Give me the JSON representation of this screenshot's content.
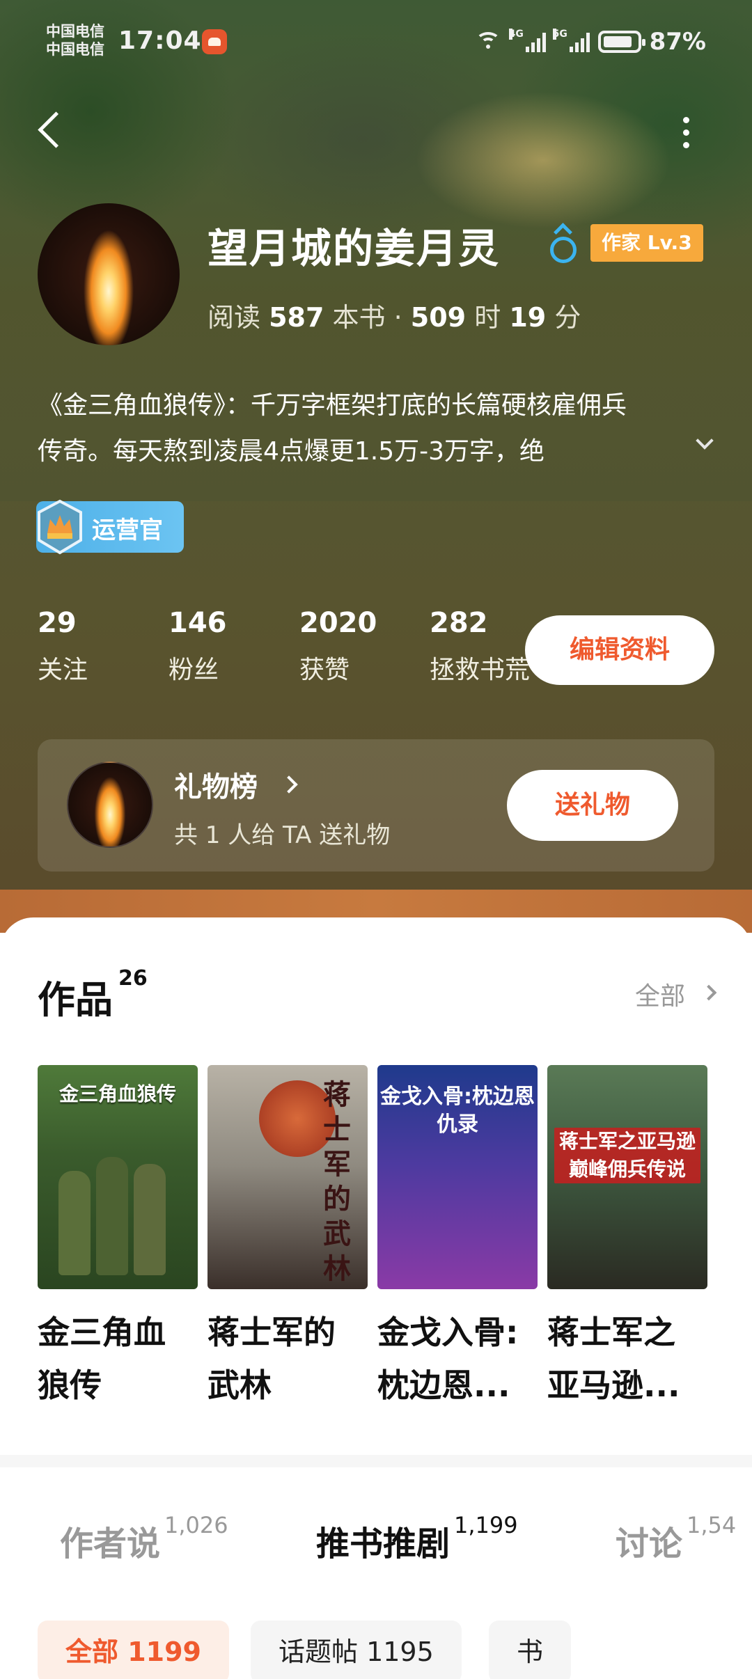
{
  "status_bar": {
    "carrier_1": "中国电信",
    "carrier_2": "中国电信",
    "time": "17:04",
    "net_1": "4G",
    "net_2": "5G",
    "battery": "87%"
  },
  "profile": {
    "username": "望月城的姜月灵",
    "level": "作家 Lv.3",
    "read_label": "阅读",
    "read_books": "587",
    "read_books_unit": "本书 ·",
    "read_hours": "509",
    "read_hours_unit": "时",
    "read_minutes": "19",
    "read_minutes_unit": "分",
    "bio_line1": "《金三角血狼传》：千万字框架打底的长篇硬核雇佣兵",
    "bio_line2": "传奇。每天熬到凌晨4点爆更1.5万-3万字，绝",
    "ops_badge": "运营官"
  },
  "stats": [
    {
      "num": "29",
      "label": "关注"
    },
    {
      "num": "146",
      "label": "粉丝"
    },
    {
      "num": "2020",
      "label": "获赞"
    },
    {
      "num": "282",
      "label": "拯救书荒"
    }
  ],
  "edit_button": "编辑资料",
  "gift": {
    "title": "礼物榜",
    "subtitle": "共 1 人给 TA 送礼物",
    "button": "送礼物"
  },
  "works": {
    "title": "作品",
    "count": "26",
    "all": "全部",
    "books": [
      {
        "title": "金三角血狼传",
        "title_lines": [
          "金三角血",
          "狼传"
        ],
        "cover_text": "金三角血狼传"
      },
      {
        "title": "蒋士军的武林",
        "title_lines": [
          "蒋士军的",
          "武林"
        ],
        "cover_text": "蒋士军的武林"
      },
      {
        "title": "金戈入骨：枕边恩仇录",
        "title_lines": [
          "金戈入骨:",
          "枕边恩..."
        ],
        "cover_text": "金戈入骨:枕边恩仇录"
      },
      {
        "title": "蒋士军之亚马逊巅峰佣兵传说",
        "title_lines": [
          "蒋士军之",
          "亚马逊..."
        ],
        "cover_text": "蒋士军之亚马逊巅峰佣兵传说"
      }
    ]
  },
  "tabs": [
    {
      "label": "作者说",
      "count": "1,026"
    },
    {
      "label": "推书推剧",
      "count": "1,199"
    },
    {
      "label": "讨论",
      "count": "1,54"
    }
  ],
  "chips": [
    {
      "label": "全部 1199"
    },
    {
      "label": "话题帖 1195"
    },
    {
      "label": "书"
    }
  ]
}
